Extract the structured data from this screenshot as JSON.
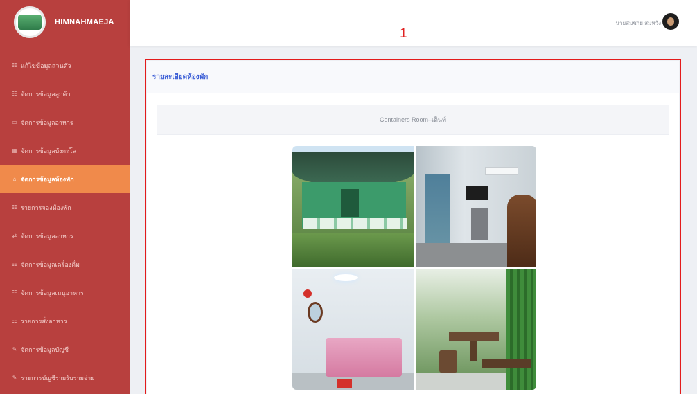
{
  "sidebar": {
    "brand": "HIMNAHMAEJA",
    "items": [
      {
        "icon": "☷",
        "label": "แก้ไขข้อมูลส่วนตัว"
      },
      {
        "icon": "☷",
        "label": "จัดการข้อมูลลูกค้า"
      },
      {
        "icon": "▭",
        "label": "จัดการข้อมูลอาหาร"
      },
      {
        "icon": "▦",
        "label": "จัดการข้อมูลบังกะโล"
      },
      {
        "icon": "⌂",
        "label": "จัดการข้อมูลห้องพัก"
      },
      {
        "icon": "☷",
        "label": "รายการจองห้องพัก"
      },
      {
        "icon": "⇄",
        "label": "จัดการข้อมูลอาหาร"
      },
      {
        "icon": "☷",
        "label": "จัดการข้อมูลเครื่องดื่ม"
      },
      {
        "icon": "☷",
        "label": "จัดการข้อมูลเมนูอาหาร"
      },
      {
        "icon": "☷",
        "label": "รายการสั่งอาหาร"
      },
      {
        "icon": "✎",
        "label": "จัดการข้อมูลบัญชี"
      },
      {
        "icon": "✎",
        "label": "รายการบัญชีรายรับรายจ่าย"
      }
    ],
    "active_index": 4
  },
  "topbar": {
    "user_name": "นายสมชาย สมหวัง"
  },
  "annotation": {
    "number": "1",
    "color": "#e31b1b"
  },
  "card": {
    "title": "รายละเอียดห้องพัก",
    "room_name": "Containers Room–เต็นท์"
  },
  "photos": [
    {
      "alt": "Container room exterior"
    },
    {
      "alt": "Room interior with TV and dresser"
    },
    {
      "alt": "Bedroom with pink bed"
    },
    {
      "alt": "Outdoor patio with wooden furniture"
    }
  ],
  "colors": {
    "sidebar": "#b8403e",
    "active_item": "#f08a4b",
    "title_link": "#3d5fd6"
  }
}
